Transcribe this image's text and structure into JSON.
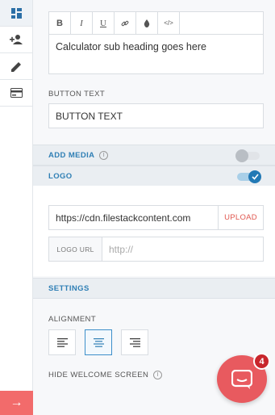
{
  "rail": {
    "items": [
      {
        "icon": "dashboard-icon",
        "active": true
      },
      {
        "icon": "add-user-icon",
        "active": false
      },
      {
        "icon": "pencil-icon",
        "active": false
      },
      {
        "icon": "credit-card-icon",
        "active": false
      }
    ],
    "bottom_icon": "arrow-right-icon",
    "bottom_glyph": "→"
  },
  "editor": {
    "toolbar": [
      {
        "name": "bold-button",
        "glyph": "B"
      },
      {
        "name": "italic-button",
        "glyph": "I"
      },
      {
        "name": "underline-button",
        "glyph": "U"
      },
      {
        "name": "link-button",
        "glyph": "🔗"
      },
      {
        "name": "color-button",
        "glyph": "●"
      },
      {
        "name": "code-button",
        "glyph": "</>"
      }
    ],
    "content": "Calculator sub heading goes here"
  },
  "button_text": {
    "label": "BUTTON TEXT",
    "value": "BUTTON TEXT"
  },
  "add_media": {
    "label": "ADD MEDIA",
    "enabled": false
  },
  "logo": {
    "label": "LOGO",
    "enabled": true,
    "url_value": "https://cdn.filestackcontent.com",
    "upload_label": "UPLOAD",
    "url_prefix": "LOGO URL",
    "url_placeholder": "http://"
  },
  "settings": {
    "label": "SETTINGS",
    "alignment_label": "ALIGNMENT",
    "alignment_options": [
      "left",
      "center",
      "right"
    ],
    "alignment_selected": "center",
    "hide_welcome_label": "HIDE WELCOME SCREEN"
  },
  "chat": {
    "badge_count": "4"
  },
  "colors": {
    "accent_blue": "#2279b5",
    "chat_red": "#e85a5f",
    "upload_red": "#e0574f",
    "rail_bottom": "#f26b6b"
  }
}
